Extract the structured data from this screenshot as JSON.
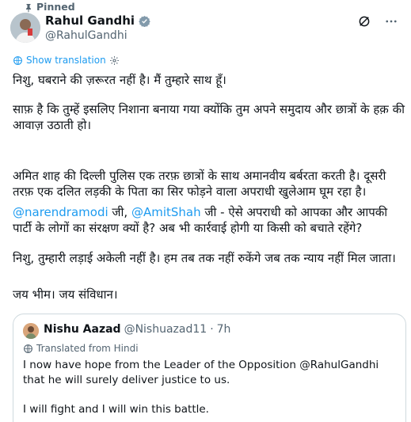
{
  "pinned_label": "Pinned",
  "author": {
    "display_name": "Rahul Gandhi",
    "handle": "@RahulGandhi"
  },
  "show_translation": "Show translation",
  "tweet": {
    "p1": "निशु, घबराने की ज़रूरत नहीं है। मैं तुम्हारे साथ हूँ।",
    "p2": "साफ़ है कि तुम्हें इसलिए निशाना बनाया गया क्योंकि तुम अपने समुदाय और छात्रों के हक़ की आवाज़ उठाती हो।",
    "p3": "अमित शाह की दिल्ली पुलिस एक तरफ़ छात्रों के साथ अमानवीय बर्बरता करती है। दूसरी तरफ़ एक दलित लड़की के पिता का सिर फोड़ने वाला अपराधी खुलेआम घूम रहा है।",
    "p4_mention1": "@narendramodi",
    "p4_mid1": " जी, ",
    "p4_mention2": "@AmitShah",
    "p4_rest": " जी - ऐसे अपराधी को आपका और आपकी पार्टी के लोगों का संरक्षण क्यों है? अब भी कार्रवाई होगी या किसी को बचाते रहेंगे?",
    "p5": "निशु, तुम्हारी लड़ाई अकेली नहीं है। हम तब तक नहीं रुकेंगे जब तक न्याय नहीं मिल जाता।",
    "p6": "जय भीम। जय संविधान।"
  },
  "quote": {
    "name": "Nishu Aazad",
    "handle": "@Nishuazad11",
    "separator": "·",
    "time": "7h",
    "translated_label": "Translated from Hindi",
    "p1": "I now have hope from the Leader of the Opposition @RahulGandhi that he will surely deliver justice to us.",
    "p2": "I will fight and I will win this battle."
  },
  "colors": {
    "accent": "#1d9bf0",
    "secondary_text": "#536471",
    "border": "#cfd9de"
  },
  "icons": [
    "pin-icon",
    "verified-badge-icon",
    "grok-icon",
    "more-icon",
    "gear-icon",
    "translate-icon"
  ]
}
